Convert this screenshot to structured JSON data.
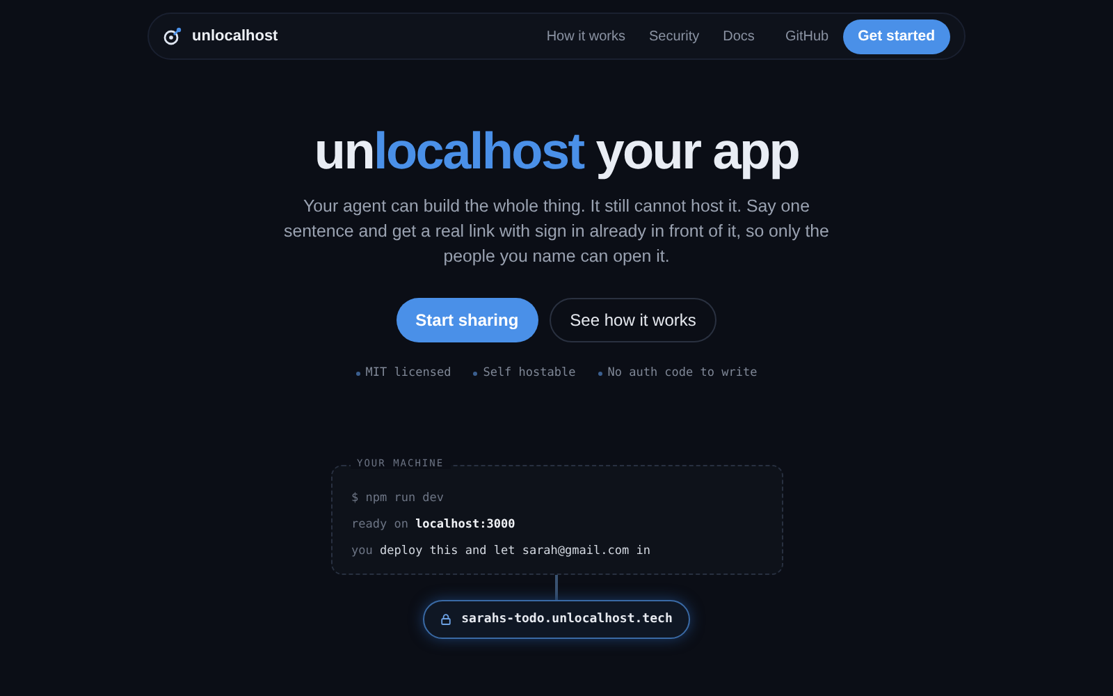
{
  "nav": {
    "brand": "unlocalhost",
    "links": [
      "How it works",
      "Security",
      "Docs",
      "GitHub"
    ],
    "cta": "Get started"
  },
  "hero": {
    "headline": [
      {
        "text": "un",
        "accent": false
      },
      {
        "text": "localhost",
        "accent": true
      },
      {
        "text": " your app",
        "accent": false
      }
    ],
    "subtitle": "Your agent can build the whole thing. It still cannot host it. Say one sentence and get a real link with sign in already in front of it, so only the people you name can open it.",
    "buttons": [
      {
        "label": "Start sharing",
        "kind": "primary"
      },
      {
        "label": "See how it works",
        "kind": "secondary"
      }
    ],
    "features": [
      "MIT licensed",
      "Self hostable",
      "No auth code to write"
    ]
  },
  "terminal": {
    "label": "YOUR MACHINE",
    "lines": [
      [
        {
          "text": "$ npm run dev",
          "kind": "muted"
        }
      ],
      [
        {
          "text": "ready on ",
          "kind": "muted"
        },
        {
          "text": "localhost:3000",
          "kind": "bold"
        }
      ],
      [
        {
          "text": "you ",
          "kind": "muted"
        },
        {
          "text": "deploy this and let sarah@gmail.com in",
          "kind": "plain"
        }
      ]
    ],
    "url": "sarahs-todo.unlocalhost.tech"
  }
}
